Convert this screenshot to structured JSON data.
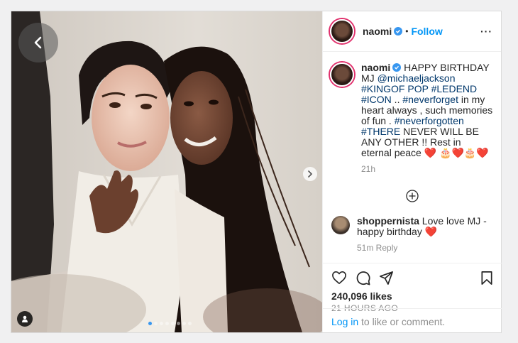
{
  "header": {
    "username": "naomi",
    "separator": "•",
    "follow_label": "Follow",
    "more_label": "···"
  },
  "caption": {
    "username": "naomi",
    "parts": {
      "t1": "HAPPY BIRTHDAY MJ ",
      "m1": "@michaeljackson",
      "h1": "#KINGOF",
      "t2": " ",
      "h2": "POP",
      "t3": " ",
      "h3": "#LEDEND",
      "t4": " ",
      "h4": "#ICON",
      "t5": " .. ",
      "h5": "#neverforget",
      "t6": " in my heart always , such memories of fun . ",
      "h6": "#neverforgotten",
      "t7": " ",
      "h7": "#THERE",
      "t8": " NEVER WILL BE ANY OTHER !! Rest in eternal peace ",
      "emoji": "❤️ 🎂❤️🎂❤️"
    },
    "time": "21h"
  },
  "comments": [
    {
      "username": "shoppernista",
      "text": "Love love MJ - happy birthday ❤️",
      "meta": "51m   Reply"
    }
  ],
  "actions": {
    "likes": "240,096 likes",
    "posted": "21 HOURS AGO"
  },
  "login": {
    "link": "Log in",
    "rest": " to like or comment."
  },
  "carousel": {
    "count": 8,
    "active_index": 0
  },
  "colors": {
    "accent": "#0095f6",
    "verified": "#3897f0",
    "heart": "#ed4956"
  }
}
